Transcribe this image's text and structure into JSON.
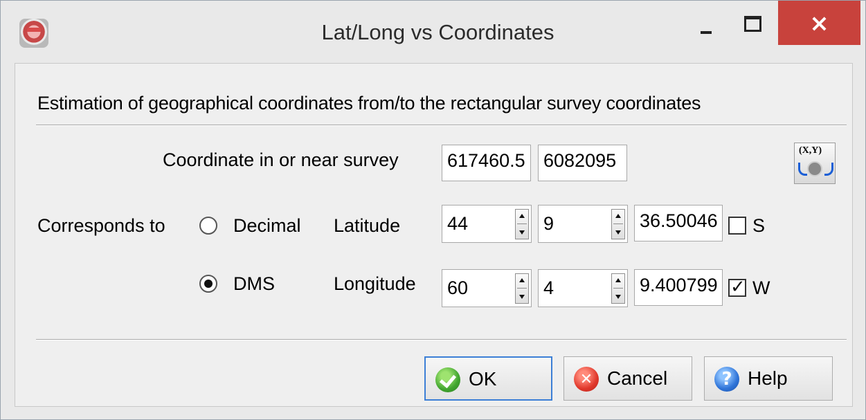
{
  "window": {
    "title": "Lat/Long vs Coordinates",
    "close_glyph": "×",
    "accent": "#c8423c"
  },
  "description": "Estimation of geographical coordinates from/to the rectangular survey coordinates",
  "survey": {
    "label": "Coordinate in or near survey",
    "x_value": "617460.5",
    "y_value": "6082095",
    "convert_icon_text": "(X,Y)"
  },
  "corresponds_label": "Corresponds to",
  "format_options": [
    {
      "label": "Decimal",
      "selected": false
    },
    {
      "label": "DMS",
      "selected": true
    }
  ],
  "latitude": {
    "label": "Latitude",
    "degrees": "44",
    "minutes": "9",
    "seconds": "36.50046",
    "hemisphere_label": "S",
    "hemisphere_checked": false
  },
  "longitude": {
    "label": "Longitude",
    "degrees": "60",
    "minutes": "4",
    "seconds": "9.400799",
    "hemisphere_label": "W",
    "hemisphere_checked": true
  },
  "buttons": {
    "ok": "OK",
    "cancel": "Cancel",
    "help": "Help"
  },
  "icons": {
    "ok": "check-circle-icon",
    "cancel": "x-circle-icon",
    "help": "question-circle-icon",
    "cancel_glyph": "✕",
    "help_glyph": "?",
    "check_glyph": "✓"
  }
}
